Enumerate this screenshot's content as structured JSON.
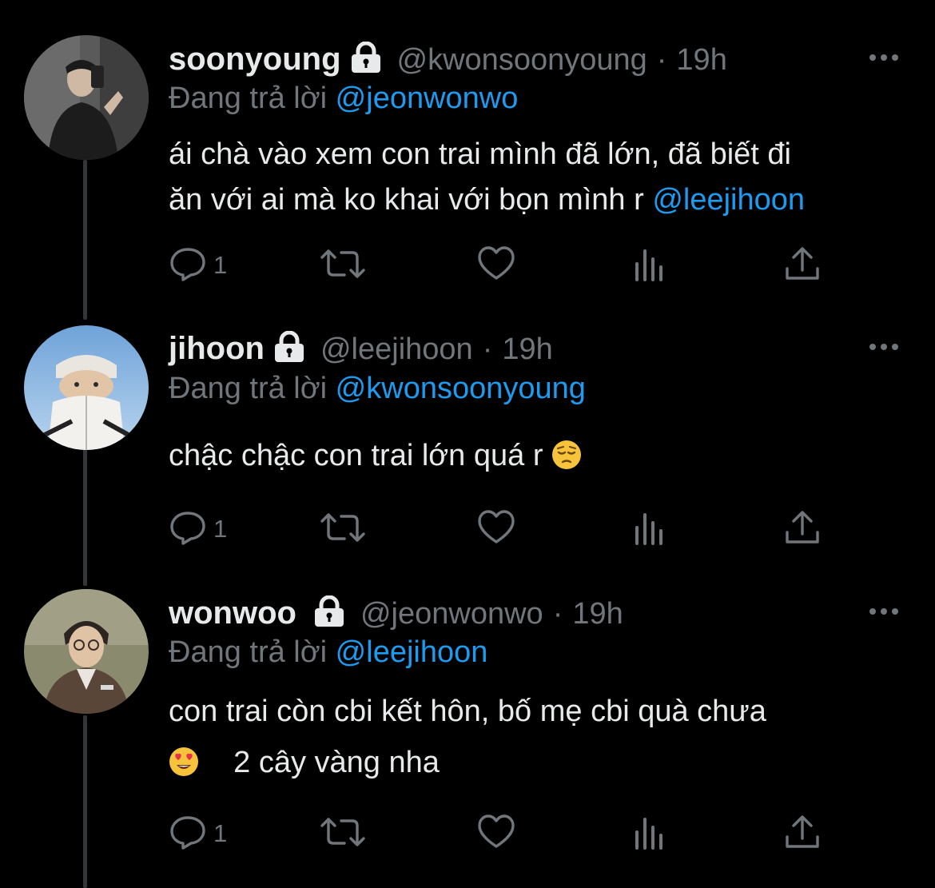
{
  "tweets": [
    {
      "name": "soonyoung",
      "handle": "@kwonsoonyoung",
      "separator": "·",
      "time": "19h",
      "reply_prefix": "Đang trả lời",
      "reply_to": "@jeonwonwo",
      "text_line1": "ái chà vào xem con trai mình đã lớn, đã biết đi",
      "text_line2": "ăn với ai mà ko khai với bọn mình r",
      "text_mention": "@leejihoon",
      "reply_count": "1"
    },
    {
      "name": "jihoon",
      "handle": "@leejihoon",
      "separator": "·",
      "time": "19h",
      "reply_prefix": "Đang trả lời",
      "reply_to": "@kwonsoonyoung",
      "text_line1": "chậc chậc con trai lớn quá r",
      "text_emoji": "pensive-face",
      "reply_count": "1"
    },
    {
      "name": "wonwoo",
      "handle": "@jeonwonwo",
      "separator": "·",
      "time": "19h",
      "reply_prefix": "Đang trả lời",
      "reply_to": "@leejihoon",
      "text_line1": "con trai còn cbi kết hôn, bố mẹ cbi quà chưa",
      "text_emoji": "heart-eyes-face",
      "text_line2": "2 cây vàng nha",
      "reply_count": "1"
    }
  ],
  "colors": {
    "background": "#000000",
    "primary_text": "#e7e9ea",
    "secondary_text": "#71767b",
    "accent": "#1d9bf0",
    "thread_line": "#333639"
  },
  "icons": [
    "lock-icon",
    "more-icon",
    "reply-icon",
    "retweet-icon",
    "like-icon",
    "views-icon",
    "share-icon"
  ]
}
